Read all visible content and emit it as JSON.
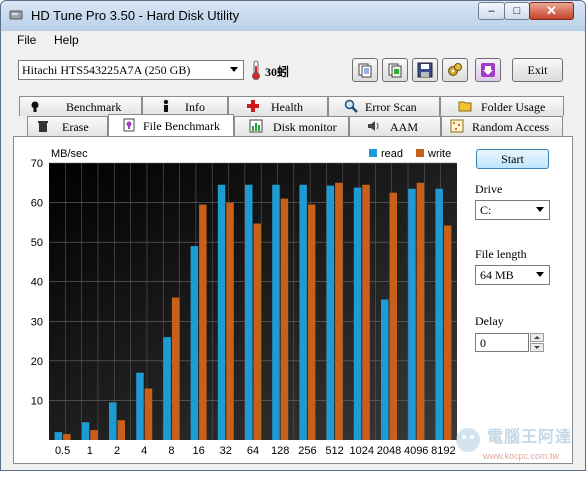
{
  "window": {
    "title": "HD Tune Pro 3.50 - Hard Disk Utility",
    "min_glyph": "–",
    "max_glyph": "□",
    "close_glyph": "✕"
  },
  "menu": {
    "file": "File",
    "help": "Help"
  },
  "toolbar": {
    "drive": "Hitachi HTS543225A7A (250 GB)",
    "temperature": "30蚓",
    "exit_label": "Exit",
    "buttons": [
      "copy-text-icon",
      "copy-screenshot-icon",
      "save-icon",
      "options-icon",
      "download-icon"
    ]
  },
  "tabs": {
    "row1": [
      "Benchmark",
      "Info",
      "Health",
      "Error Scan",
      "Folder Usage"
    ],
    "row2": [
      "Erase",
      "File Benchmark",
      "Disk monitor",
      "AAM",
      "Random Access"
    ],
    "active": "File Benchmark"
  },
  "side": {
    "start_label": "Start",
    "drive_label": "Drive",
    "drive_value": "C:",
    "file_length_label": "File length",
    "file_length_value": "64 MB",
    "delay_label": "Delay",
    "delay_value": "0"
  },
  "chart_data": {
    "type": "bar",
    "ylabel": "MB/sec",
    "ylim": [
      0,
      70
    ],
    "yticks": [
      10,
      20,
      30,
      40,
      50,
      60,
      70
    ],
    "categories": [
      "0.5",
      "1",
      "2",
      "4",
      "8",
      "16",
      "32",
      "64",
      "128",
      "256",
      "512",
      "1024",
      "2048",
      "4096",
      "8192"
    ],
    "series": [
      {
        "name": "read",
        "color": "#1e9bd2",
        "values": [
          2,
          4.5,
          9.5,
          17,
          26,
          49,
          64.5,
          64.5,
          64.5,
          64.5,
          64.3,
          63.8,
          35.5,
          63.5,
          63.5
        ]
      },
      {
        "name": "write",
        "color": "#c8601a",
        "values": [
          1.5,
          2.5,
          5,
          13,
          36,
          59.5,
          60,
          54.7,
          61,
          59.5,
          65,
          64.5,
          62.5,
          65,
          54.2
        ]
      }
    ],
    "legend_position": "top-right",
    "grid": true
  },
  "watermark": {
    "text": "電腦王阿達",
    "url": "www.kocpc.com.tw"
  }
}
